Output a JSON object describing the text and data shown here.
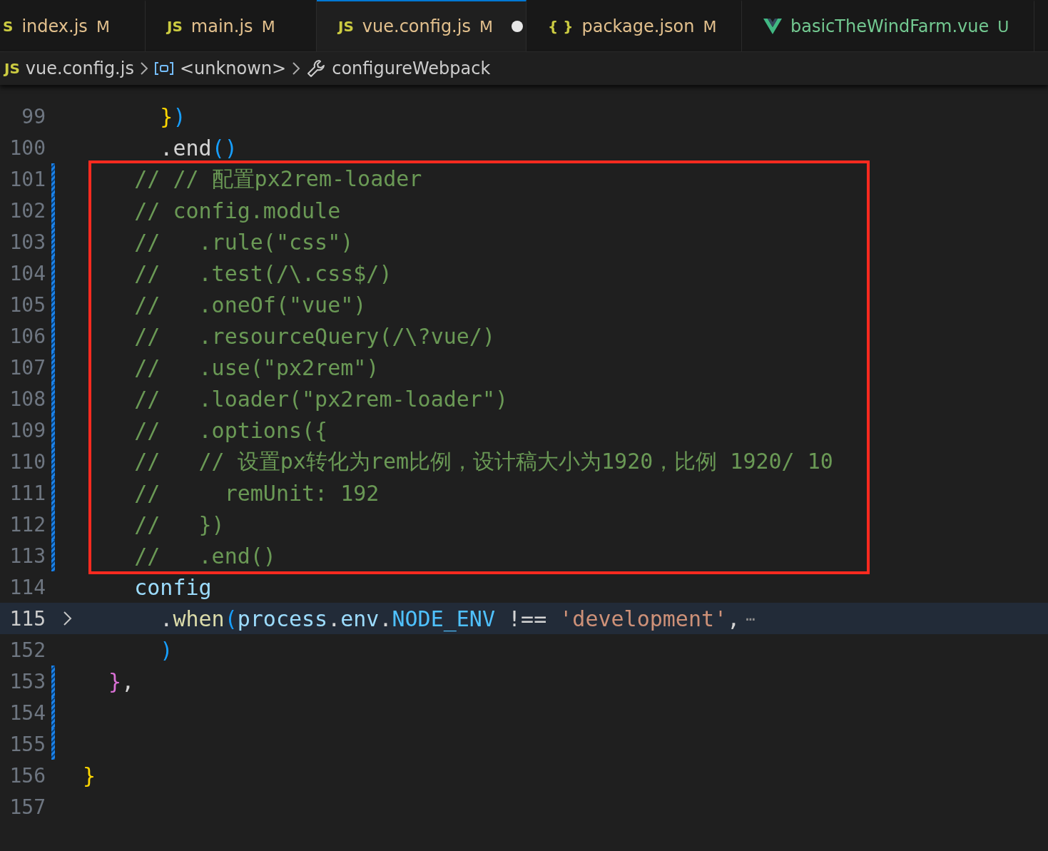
{
  "tabs": [
    {
      "icon_text": "S",
      "kind": "script",
      "label": "index.js",
      "status": "M",
      "selected": false,
      "dirty": false
    },
    {
      "icon_text": "JS",
      "kind": "script",
      "label": "main.js",
      "status": "M",
      "selected": false,
      "dirty": false
    },
    {
      "icon_text": "JS",
      "kind": "script",
      "label": "vue.config.js",
      "status": "M",
      "selected": true,
      "dirty": true
    },
    {
      "icon_text": "{ }",
      "kind": "json",
      "label": "package.json",
      "status": "M",
      "selected": false,
      "dirty": false
    },
    {
      "kind": "vue",
      "label": "basicTheWindFarm.vue",
      "status": "U",
      "selected": false,
      "dirty": false
    }
  ],
  "breadcrumb": [
    {
      "kind": "file",
      "icon_text": "JS",
      "label": "vue.config.js"
    },
    {
      "kind": "symbol",
      "label": "<unknown>"
    },
    {
      "kind": "method",
      "label": "configureWebpack"
    }
  ],
  "lines": [
    {
      "number": "99",
      "modified": false,
      "boxed": false,
      "current": false,
      "foldable": false,
      "tokens": [
        {
          "kind": "bracket1",
          "text": "      }"
        },
        {
          "kind": "bracket2",
          "text": ")"
        }
      ]
    },
    {
      "number": "100",
      "modified": false,
      "boxed": false,
      "current": false,
      "foldable": false,
      "tokens": [
        {
          "kind": "plain",
          "text": "      .end"
        },
        {
          "kind": "bracket2",
          "text": "()"
        }
      ]
    },
    {
      "number": "101",
      "modified": true,
      "boxed": true,
      "current": false,
      "foldable": false,
      "tokens": [
        {
          "kind": "comment",
          "text": "    // // 配置px2rem-loader"
        }
      ]
    },
    {
      "number": "102",
      "modified": true,
      "boxed": true,
      "current": false,
      "foldable": false,
      "tokens": [
        {
          "kind": "comment",
          "text": "    // config.module"
        }
      ]
    },
    {
      "number": "103",
      "modified": true,
      "boxed": true,
      "current": false,
      "foldable": false,
      "tokens": [
        {
          "kind": "comment",
          "text": "    //   .rule(\"css\")"
        }
      ]
    },
    {
      "number": "104",
      "modified": true,
      "boxed": true,
      "current": false,
      "foldable": false,
      "tokens": [
        {
          "kind": "comment",
          "text": "    //   .test(/\\.css$/)"
        }
      ]
    },
    {
      "number": "105",
      "modified": true,
      "boxed": true,
      "current": false,
      "foldable": false,
      "tokens": [
        {
          "kind": "comment",
          "text": "    //   .oneOf(\"vue\")"
        }
      ]
    },
    {
      "number": "106",
      "modified": true,
      "boxed": true,
      "current": false,
      "foldable": false,
      "tokens": [
        {
          "kind": "comment",
          "text": "    //   .resourceQuery(/\\?vue/)"
        }
      ]
    },
    {
      "number": "107",
      "modified": true,
      "boxed": true,
      "current": false,
      "foldable": false,
      "tokens": [
        {
          "kind": "comment",
          "text": "    //   .use(\"px2rem\")"
        }
      ]
    },
    {
      "number": "108",
      "modified": true,
      "boxed": true,
      "current": false,
      "foldable": false,
      "tokens": [
        {
          "kind": "comment",
          "text": "    //   .loader(\"px2rem-loader\")"
        }
      ]
    },
    {
      "number": "109",
      "modified": true,
      "boxed": true,
      "current": false,
      "foldable": false,
      "tokens": [
        {
          "kind": "comment",
          "text": "    //   .options({"
        }
      ]
    },
    {
      "number": "110",
      "modified": true,
      "boxed": true,
      "current": false,
      "foldable": false,
      "tokens": [
        {
          "kind": "comment",
          "text": "    //   // 设置px转化为rem比例，设计稿大小为1920，比例 1920/ 10"
        }
      ]
    },
    {
      "number": "111",
      "modified": true,
      "boxed": true,
      "current": false,
      "foldable": false,
      "tokens": [
        {
          "kind": "comment",
          "text": "    //     remUnit: 192"
        }
      ]
    },
    {
      "number": "112",
      "modified": true,
      "boxed": true,
      "current": false,
      "foldable": false,
      "tokens": [
        {
          "kind": "comment",
          "text": "    //   })"
        }
      ]
    },
    {
      "number": "113",
      "modified": true,
      "boxed": true,
      "current": false,
      "foldable": false,
      "tokens": [
        {
          "kind": "comment",
          "text": "    //   .end()"
        }
      ]
    },
    {
      "number": "114",
      "modified": false,
      "boxed": false,
      "current": false,
      "foldable": false,
      "tokens": [
        {
          "kind": "variable",
          "text": "    config"
        }
      ]
    },
    {
      "number": "115",
      "modified": false,
      "boxed": false,
      "current": true,
      "foldable": true,
      "tokens": [
        {
          "kind": "plain",
          "text": "      ."
        },
        {
          "kind": "function",
          "text": "when"
        },
        {
          "kind": "bracket2",
          "text": "("
        },
        {
          "kind": "variable",
          "text": "process"
        },
        {
          "kind": "plain",
          "text": "."
        },
        {
          "kind": "variable",
          "text": "env"
        },
        {
          "kind": "plain",
          "text": "."
        },
        {
          "kind": "const",
          "text": "NODE_ENV"
        },
        {
          "kind": "plain",
          "text": " !== "
        },
        {
          "kind": "string",
          "text": "'development'"
        },
        {
          "kind": "plain",
          "text": ","
        },
        {
          "kind": "fold",
          "text": "⋯"
        }
      ]
    },
    {
      "number": "152",
      "modified": false,
      "boxed": false,
      "current": false,
      "foldable": false,
      "tokens": [
        {
          "kind": "bracket2",
          "text": "      )"
        }
      ]
    },
    {
      "number": "153",
      "modified": true,
      "boxed": false,
      "current": false,
      "foldable": false,
      "tokens": [
        {
          "kind": "bracket3",
          "text": "  }"
        },
        {
          "kind": "plain",
          "text": ","
        }
      ]
    },
    {
      "number": "154",
      "modified": true,
      "boxed": false,
      "current": false,
      "foldable": false
    },
    {
      "number": "155",
      "modified": true,
      "boxed": false,
      "current": false,
      "foldable": false
    },
    {
      "number": "156",
      "modified": false,
      "boxed": false,
      "current": false,
      "foldable": false,
      "tokens": [
        {
          "kind": "bracket1",
          "text": "}"
        }
      ]
    },
    {
      "number": "157",
      "modified": false,
      "boxed": false,
      "current": false,
      "foldable": false
    }
  ]
}
